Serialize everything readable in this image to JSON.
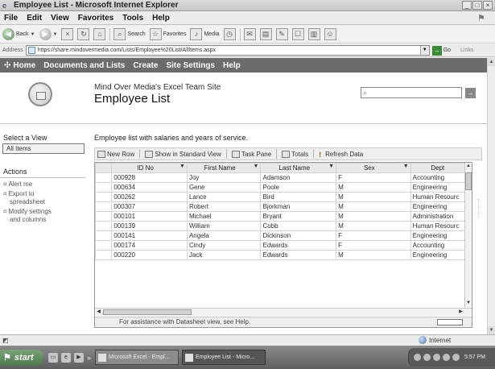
{
  "window": {
    "title": "Employee List - Microsoft Internet Explorer"
  },
  "menu": [
    "File",
    "Edit",
    "View",
    "Favorites",
    "Tools",
    "Help"
  ],
  "toolbar": {
    "back": "Back",
    "search": "Search",
    "favorites": "Favorites",
    "media": "Media"
  },
  "address": {
    "label": "Address",
    "url": "https://share.mindovermedia.com/Lists/Employee%20List/AllItems.aspx",
    "go": "Go",
    "links": "Links"
  },
  "topnav": [
    "Home",
    "Documents and Lists",
    "Create",
    "Site Settings",
    "Help"
  ],
  "site": {
    "name": "Mind Over Media's Excel Team Site",
    "list_title": "Employee List"
  },
  "leftnav": {
    "select_view": "Select a View",
    "all_items": "All Items",
    "actions": "Actions",
    "alert": "Alert me",
    "export_1": "Export to",
    "export_2": "spreadsheet",
    "modify_1": "Modify settings",
    "modify_2": "and columns"
  },
  "main": {
    "description": "Employee list with salaries and years of service."
  },
  "ds_toolbar": {
    "new_row": "New Row",
    "show_standard": "Show in Standard View",
    "task_pane": "Task Pane",
    "totals": "Totals",
    "refresh": "Refresh Data"
  },
  "grid": {
    "columns": [
      "ID No",
      "First Name",
      "Last Name",
      "Sex",
      "Dept"
    ],
    "rows": [
      [
        "000928",
        "Joy",
        "Adamson",
        "F",
        "Accounting"
      ],
      [
        "000634",
        "Gene",
        "Poole",
        "M",
        "Engineering"
      ],
      [
        "000262",
        "Lance",
        "Bird",
        "M",
        "Human Resourc"
      ],
      [
        "000307",
        "Robert",
        "Bjorkman",
        "M",
        "Engineering"
      ],
      [
        "000101",
        "Michael",
        "Bryant",
        "M",
        "Administration"
      ],
      [
        "000139",
        "William",
        "Cobb",
        "M",
        "Human Resourc"
      ],
      [
        "000141",
        "Angela",
        "Dickinson",
        "F",
        "Engineering"
      ],
      [
        "000174",
        "Cindy",
        "Edwards",
        "F",
        "Accounting"
      ],
      [
        "000220",
        "Jack",
        "Edwards",
        "M",
        "Engineering"
      ]
    ],
    "status": "For assistance with Datasheet view, see Help."
  },
  "statusbar": {
    "zone": "Internet"
  },
  "taskbar": {
    "start": "start",
    "tasks": [
      "Microsoft Excel - Empl...",
      "Employee List - Micro..."
    ],
    "clock": "5:57 PM"
  }
}
